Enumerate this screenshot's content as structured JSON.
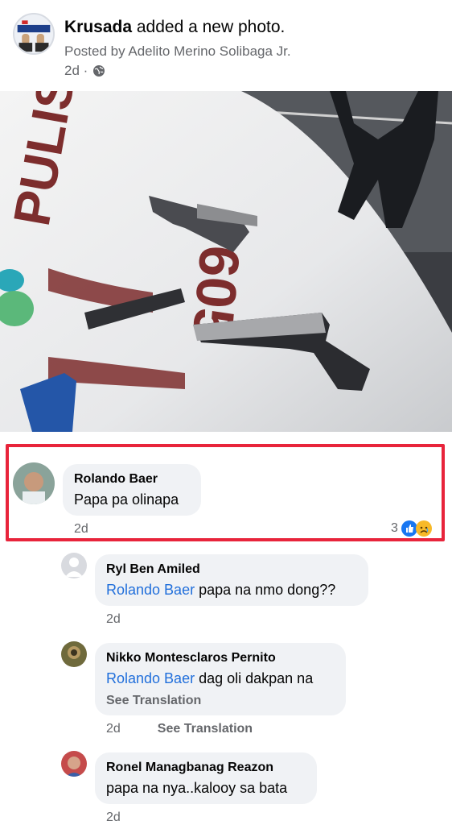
{
  "post": {
    "page_name": "Krusada",
    "action": " added a new photo.",
    "posted_by": "Posted by Adelito Merino Solibaga Jr.",
    "time": "2d ·",
    "audience_icon": "globe-icon"
  },
  "photo": {
    "vehicle_text_1": "PULISYA",
    "vehicle_text_2": "605"
  },
  "comments": [
    {
      "name": "Rolando Baer",
      "text": "Papa pa olinapa",
      "time": "2d",
      "reaction_count": "3",
      "reactions": [
        "like-icon",
        "sad-icon"
      ],
      "highlighted": true
    },
    {
      "name": "Ryl Ben Amiled",
      "mention": "Rolando Baer",
      "text": " papa na nmo dong??",
      "time": "2d"
    },
    {
      "name": "Nikko Montesclaros Pernito",
      "mention": "Rolando Baer",
      "text": " dag oli dakpan na",
      "see_translation": "See Translation",
      "time": "2d",
      "meta_see_translation": "See Translation"
    },
    {
      "name": "Ronel Managbanag Reazon",
      "text": "papa na nya..kalooy sa bata",
      "time": "2d"
    }
  ],
  "colors": {
    "highlight": "#e8243b",
    "mention": "#216fdb",
    "bubble": "#f0f2f5",
    "secondary_text": "#65676b"
  }
}
